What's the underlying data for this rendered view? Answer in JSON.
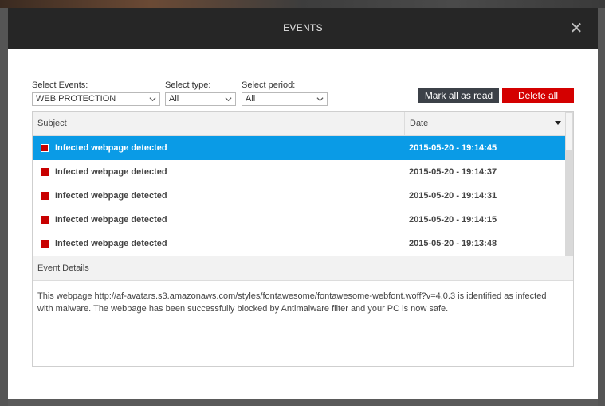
{
  "dialog": {
    "title": "EVENTS",
    "close_icon": "close-icon"
  },
  "filters": {
    "events": {
      "label": "Select Events:",
      "value": "WEB PROTECTION"
    },
    "type": {
      "label": "Select type:",
      "value": "All"
    },
    "period": {
      "label": "Select period:",
      "value": "All"
    }
  },
  "actions": {
    "mark_all_read": "Mark all as read",
    "delete_all": "Delete all"
  },
  "table": {
    "columns": {
      "subject": "Subject",
      "date": "Date"
    },
    "sort": "date-descending",
    "rows": [
      {
        "subject": "Infected webpage detected",
        "date": "2015-05-20 - 19:14:45",
        "selected": true
      },
      {
        "subject": "Infected webpage detected",
        "date": "2015-05-20 - 19:14:37",
        "selected": false
      },
      {
        "subject": "Infected webpage detected",
        "date": "2015-05-20 - 19:14:31",
        "selected": false
      },
      {
        "subject": "Infected webpage detected",
        "date": "2015-05-20 - 19:14:15",
        "selected": false
      },
      {
        "subject": "Infected webpage detected",
        "date": "2015-05-20 - 19:13:48",
        "selected": false
      }
    ]
  },
  "details": {
    "heading": "Event Details",
    "line1": "This webpage http://af-avatars.s3.amazonaws.com/styles/fontawesome/fontawesome-webfont.woff?v=4.0.3 is identified as infected",
    "line2": "with malware. The webpage has been successfully blocked by Antimalware filter and your PC is now safe."
  },
  "colors": {
    "titlebar": "#262626",
    "selected_row": "#0a9be6",
    "delete_button": "#d40000",
    "mark_button": "#3c4148",
    "event_marker": "#c80000"
  }
}
